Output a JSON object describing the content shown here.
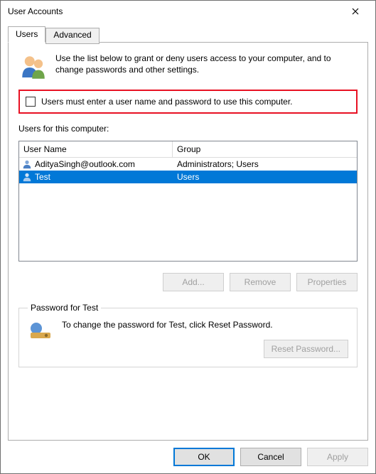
{
  "window": {
    "title": "User Accounts"
  },
  "tabs": {
    "users": "Users",
    "advanced": "Advanced"
  },
  "intro": "Use the list below to grant or deny users access to your computer, and to change passwords and other settings.",
  "checkbox_label": "Users must enter a user name and password to use this computer.",
  "users_section_label": "Users for this computer:",
  "columns": {
    "username": "User Name",
    "group": "Group"
  },
  "rows": [
    {
      "username": "AdityaSingh@outlook.com",
      "group": "Administrators; Users",
      "selected": false
    },
    {
      "username": "Test",
      "group": "Users",
      "selected": true
    }
  ],
  "buttons": {
    "add": "Add...",
    "remove": "Remove",
    "properties": "Properties",
    "reset_password": "Reset Password...",
    "ok": "OK",
    "cancel": "Cancel",
    "apply": "Apply"
  },
  "password_group": {
    "legend": "Password for Test",
    "text": "To change the password for Test, click Reset Password."
  }
}
